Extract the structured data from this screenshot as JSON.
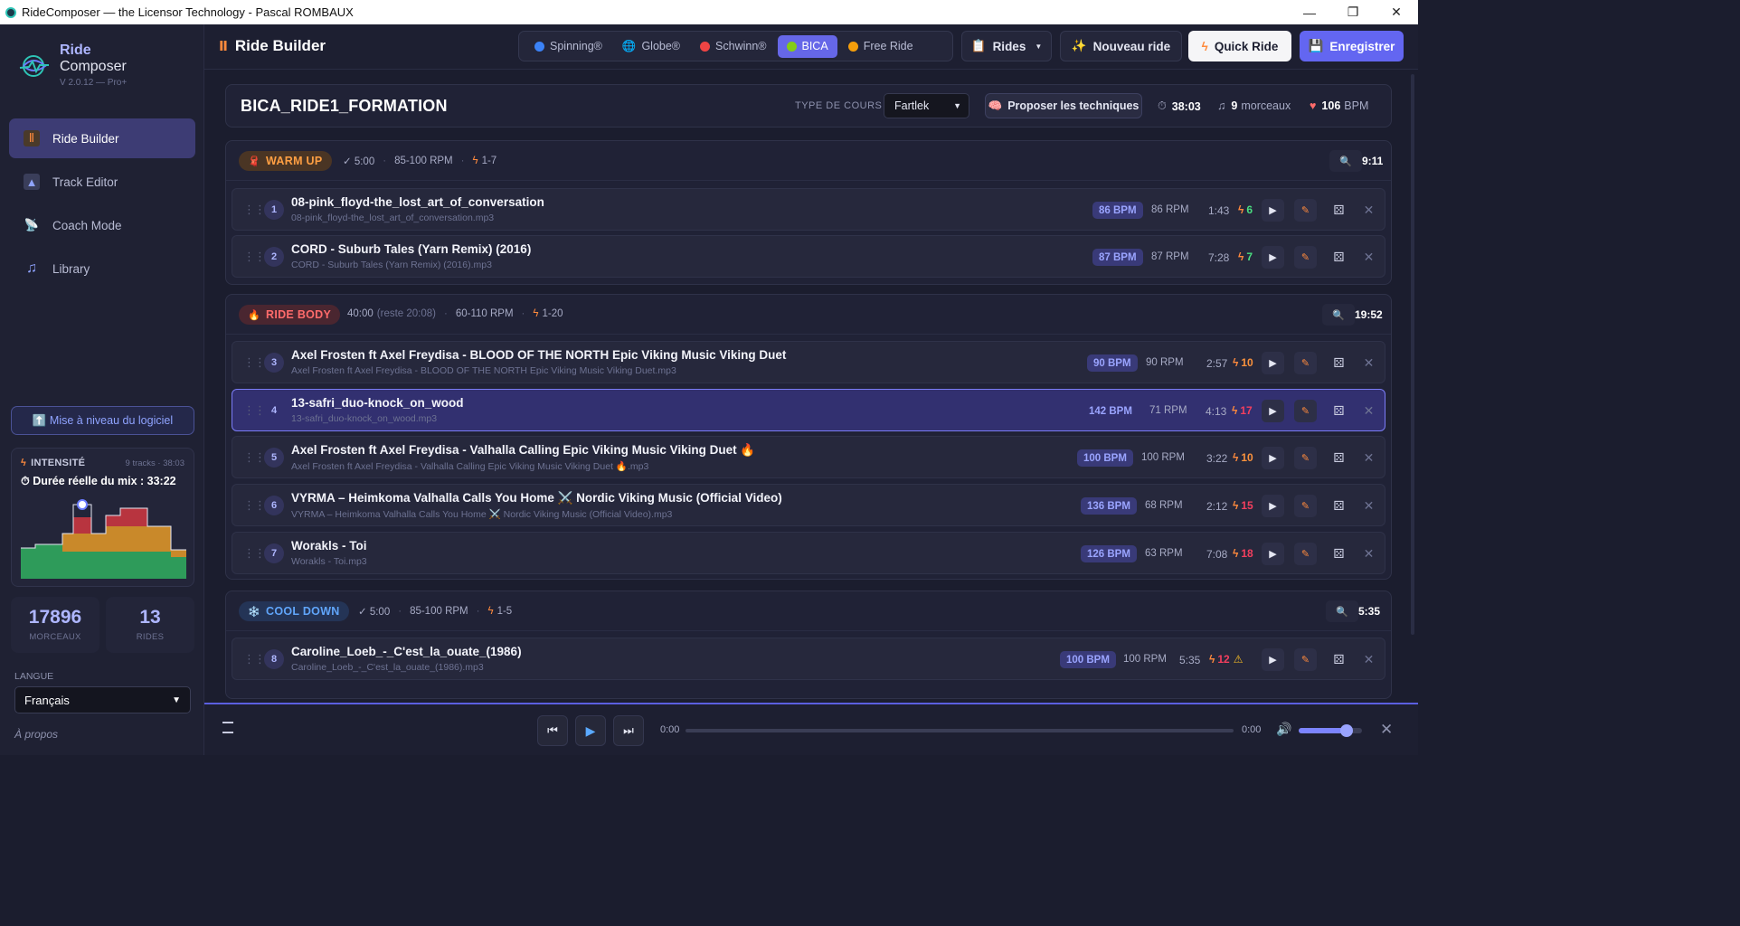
{
  "window": {
    "title": "RideComposer — the Licensor Technology - Pascal ROMBAUX"
  },
  "brand": {
    "name_line1": "Ride",
    "name_line2": "Composer",
    "version": "V 2.0.12 — Pro+"
  },
  "nav": [
    {
      "label": "Ride Builder",
      "icon": "ride-builder-icon",
      "active": true
    },
    {
      "label": "Track Editor",
      "icon": "track-editor-icon"
    },
    {
      "label": "Coach Mode",
      "icon": "coach-mode-icon"
    },
    {
      "label": "Library",
      "icon": "music-note-icon"
    }
  ],
  "upgrade": {
    "label": "⬆️ Mise à niveau du logiciel"
  },
  "intensity": {
    "title": "INTENSITÉ",
    "meta": "9 tracks · 38:03",
    "duration": "⏱ Durée réelle du mix : 33:22",
    "colors": {
      "green": "#2e9b5a",
      "orange": "#c9892a",
      "red": "#b8343f"
    }
  },
  "stats": [
    {
      "value": "17896",
      "label": "MORCEAUX"
    },
    {
      "value": "13",
      "label": "RIDES"
    }
  ],
  "language": {
    "label": "LANGUE",
    "value": "Français"
  },
  "about": "À propos",
  "header": {
    "title": "Ride Builder",
    "tabs": [
      {
        "label": "Spinning®",
        "dot": "#3b82f6"
      },
      {
        "label": "Globe®",
        "dot": "#3b82f6"
      },
      {
        "label": "Schwinn®",
        "dot": "#ef4444"
      },
      {
        "label": "BICA",
        "dot": "#84cc16",
        "active": true
      },
      {
        "label": "Free Ride",
        "dot": "#f59e0b"
      }
    ],
    "rides_label": "Rides",
    "new_ride_label": "Nouveau ride",
    "quick_ride_label": "Quick Ride",
    "save_label": "Enregistrer"
  },
  "ride": {
    "name": "BICA_RIDE1_FORMATION",
    "type_label": "TYPE DE COURS",
    "type_value": "Fartlek",
    "propose_label": "Proposer les techniques",
    "total_time": "38:03",
    "tracks_count": "9",
    "tracks_unit": "morceaux",
    "bpm": "106",
    "bpm_unit": "BPM"
  },
  "sections": [
    {
      "name": "WARM UP",
      "icon": "🧣",
      "duration": "✓ 5:00",
      "rpm": "85-100 RPM",
      "levels": "1-7",
      "total": "9:11",
      "tracks": [
        {
          "n": "1",
          "title": "08-pink_floyd-the_lost_art_of_conversation",
          "file": "08-pink_floyd-the_lost_art_of_conversation.mp3",
          "bpm": "86 BPM",
          "rpm": "86 RPM",
          "dur": "1:43",
          "lvl": "6",
          "lvl_color": "#4ade80"
        },
        {
          "n": "2",
          "title": "CORD - Suburb Tales (Yarn Remix) (2016)",
          "file": "CORD - Suburb Tales (Yarn Remix) (2016).mp3",
          "bpm": "87 BPM",
          "rpm": "87 RPM",
          "dur": "7:28",
          "lvl": "7",
          "lvl_color": "#4ade80"
        }
      ]
    },
    {
      "name": "RIDE BODY",
      "icon": "🔥",
      "duration": "40:00",
      "reste": "(reste 20:08)",
      "rpm": "60-110 RPM",
      "levels": "1-20",
      "total": "19:52",
      "tracks": [
        {
          "n": "3",
          "title": "Axel Frosten ft Axel Freydisa - BLOOD OF THE NORTH Epic Viking Music Viking Duet",
          "file": "Axel Frosten ft Axel Freydisa - BLOOD OF THE NORTH Epic Viking Music Viking Duet.mp3",
          "bpm": "90 BPM",
          "rpm": "90 RPM",
          "dur": "2:57",
          "lvl": "10",
          "lvl_color": "#fb923c"
        },
        {
          "n": "4",
          "title": "13-safri_duo-knock_on_wood",
          "file": "13-safri_duo-knock_on_wood.mp3",
          "bpm": "142 BPM",
          "rpm": "71 RPM",
          "dur": "4:13",
          "lvl": "17",
          "lvl_color": "#f43f5e",
          "selected": true
        },
        {
          "n": "5",
          "title": "Axel Frosten ft Axel Freydisa - Valhalla Calling Epic Viking Music Viking Duet 🔥",
          "file": "Axel Frosten ft Axel Freydisa - Valhalla Calling Epic Viking Music Viking Duet 🔥.mp3",
          "bpm": "100 BPM",
          "rpm": "100 RPM",
          "dur": "3:22",
          "lvl": "10",
          "lvl_color": "#fb923c"
        },
        {
          "n": "6",
          "title": "VYRMA – Heimkoma Valhalla Calls You Home ⚔️ Nordic Viking Music (Official Video)",
          "file": "VYRMA – Heimkoma Valhalla Calls You Home ⚔️ Nordic Viking Music (Official Video).mp3",
          "bpm": "136 BPM",
          "rpm": "68 RPM",
          "dur": "2:12",
          "lvl": "15",
          "lvl_color": "#f43f5e"
        },
        {
          "n": "7",
          "title": "Worakls - Toi",
          "file": "Worakls - Toi.mp3",
          "bpm": "126 BPM",
          "rpm": "63 RPM",
          "dur": "7:08",
          "lvl": "18",
          "lvl_color": "#f43f5e"
        }
      ]
    },
    {
      "name": "COOL DOWN",
      "icon": "❄️",
      "duration": "✓ 5:00",
      "rpm": "85-100 RPM",
      "levels": "1-5",
      "total": "5:35",
      "tracks": [
        {
          "n": "8",
          "title": "Caroline_Loeb_-_C'est_la_ouate_(1986)",
          "file": "Caroline_Loeb_-_C'est_la_ouate_(1986).mp3",
          "bpm": "100 BPM",
          "rpm": "100 RPM",
          "dur": "5:35",
          "lvl": "12",
          "lvl_color": "#f43f5e",
          "warn": "⚠"
        }
      ]
    }
  ],
  "player": {
    "current_time": "0:00",
    "total_time": "0:00",
    "progress": 0,
    "volume": 0.75
  }
}
